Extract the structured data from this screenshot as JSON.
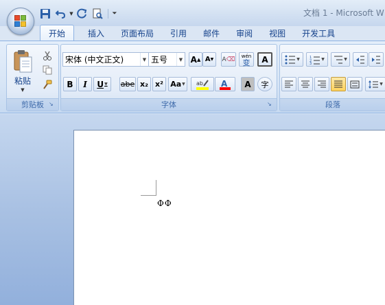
{
  "window": {
    "title": "文档 1 - Microsoft W"
  },
  "quick_access": {
    "icons": [
      "save-icon",
      "undo-icon",
      "redo-icon",
      "print-preview-icon",
      "customize-icon"
    ]
  },
  "tabs": [
    {
      "label": "开始",
      "active": true
    },
    {
      "label": "插入"
    },
    {
      "label": "页面布局"
    },
    {
      "label": "引用"
    },
    {
      "label": "邮件"
    },
    {
      "label": "审阅"
    },
    {
      "label": "视图"
    },
    {
      "label": "开发工具"
    }
  ],
  "ribbon": {
    "clipboard": {
      "label": "剪贴板",
      "paste": "粘贴"
    },
    "font": {
      "label": "字体",
      "font_name": "宋体 (中文正文)",
      "font_size": "五号",
      "bold": "B",
      "italic": "I",
      "underline": "U",
      "strikethrough": "abe",
      "subscript": "x₂",
      "superscript": "x²",
      "change_case": "Aa",
      "grow_font": "A",
      "shrink_font": "A",
      "clear_format": "A",
      "char_border": "A",
      "char_shading": "A",
      "enclose": "字",
      "phonetic": "wén",
      "phonetic_char": "变",
      "highlight_color": "#ffff00",
      "font_color_swatch": "#ff0000"
    },
    "paragraph": {
      "label": "段落",
      "justify_selected": true
    }
  },
  "document": {
    "text": "ΦΦ"
  }
}
